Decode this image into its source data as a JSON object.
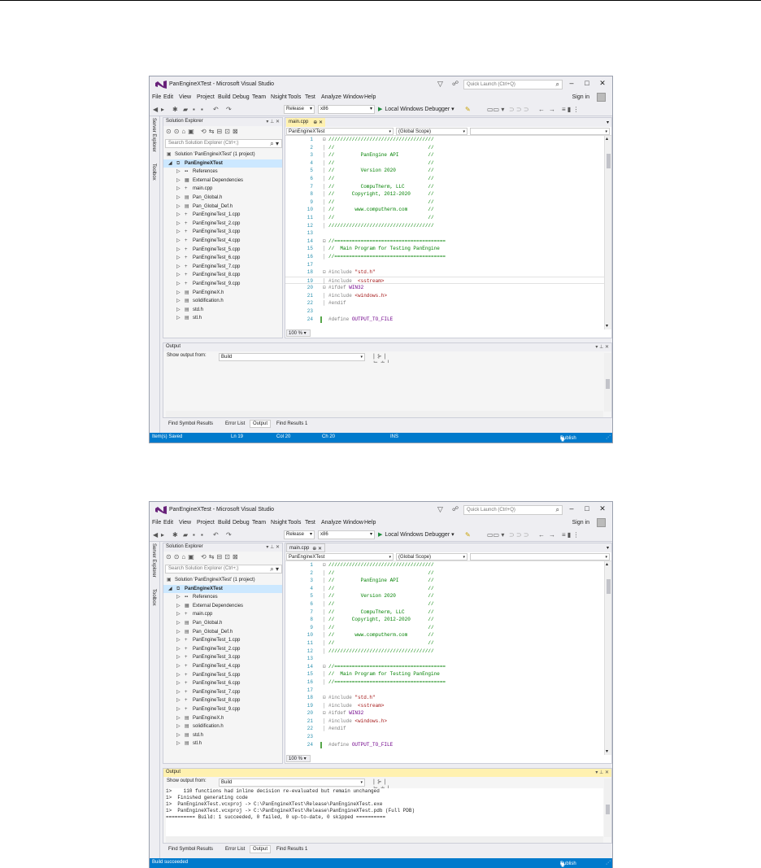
{
  "app": {
    "title": "PanEngineXTest - Microsoft Visual Studio",
    "quick_launch_placeholder": "Quick Launch (Ctrl+Q)",
    "sign_in": "Sign in"
  },
  "icons": {
    "logo": "vs-logo-icon",
    "filter": "filter-icon",
    "feedback": "feedback-icon",
    "search": "search-icon",
    "minimize": "minimize-icon",
    "maximize": "maximize-icon",
    "close": "close-icon"
  },
  "colors": {
    "accent": "#007acc",
    "logo": "#68217a",
    "active_tab": "#fff1b0",
    "selection": "#cce8ff",
    "comment": "#008000",
    "line_number": "#2b91af"
  },
  "menu": [
    "File",
    "Edit",
    "View",
    "Project",
    "Build",
    "Debug",
    "Team",
    "Nsight",
    "Tools",
    "Test",
    "Analyze",
    "Window",
    "Help"
  ],
  "toolbar": {
    "config": "Release",
    "platform": "x86",
    "run": "Local Windows Debugger"
  },
  "side_tabs": [
    "Server Explorer",
    "Toolbox"
  ],
  "solution_explorer": {
    "title": "Solution Explorer",
    "search_placeholder": "Search Solution Explorer (Ctrl+;)",
    "items": [
      {
        "label": "Solution 'PanEngineXTest' (1 project)",
        "level": 0,
        "arrow": "",
        "icon": "▣"
      },
      {
        "label": "PanEngineXTest",
        "level": 1,
        "arrow": "◢",
        "icon": "⧉",
        "bold": true,
        "selected": true
      },
      {
        "label": "References",
        "level": 2,
        "arrow": "▷",
        "icon": "▪▪"
      },
      {
        "label": "External Dependencies",
        "level": 2,
        "arrow": "▷",
        "icon": "▦"
      },
      {
        "label": "main.cpp",
        "level": 2,
        "arrow": "▷",
        "icon": "+"
      },
      {
        "label": "Pan_Global.h",
        "level": 2,
        "arrow": "▷",
        "icon": "▤"
      },
      {
        "label": "Pan_Global_Def.h",
        "level": 2,
        "arrow": "▷",
        "icon": "▤"
      },
      {
        "label": "PanEngineTest_1.cpp",
        "level": 2,
        "arrow": "▷",
        "icon": "+"
      },
      {
        "label": "PanEngineTest_2.cpp",
        "level": 2,
        "arrow": "▷",
        "icon": "+"
      },
      {
        "label": "PanEngineTest_3.cpp",
        "level": 2,
        "arrow": "▷",
        "icon": "+"
      },
      {
        "label": "PanEngineTest_4.cpp",
        "level": 2,
        "arrow": "▷",
        "icon": "+"
      },
      {
        "label": "PanEngineTest_5.cpp",
        "level": 2,
        "arrow": "▷",
        "icon": "+"
      },
      {
        "label": "PanEngineTest_6.cpp",
        "level": 2,
        "arrow": "▷",
        "icon": "+"
      },
      {
        "label": "PanEngineTest_7.cpp",
        "level": 2,
        "arrow": "▷",
        "icon": "+"
      },
      {
        "label": "PanEngineTest_8.cpp",
        "level": 2,
        "arrow": "▷",
        "icon": "+"
      },
      {
        "label": "PanEngineTest_9.cpp",
        "level": 2,
        "arrow": "▷",
        "icon": "+"
      },
      {
        "label": "PanEngineX.h",
        "level": 2,
        "arrow": "▷",
        "icon": "▤"
      },
      {
        "label": "solidification.h",
        "level": 2,
        "arrow": "▷",
        "icon": "▤"
      },
      {
        "label": "std.h",
        "level": 2,
        "arrow": "▷",
        "icon": "▤"
      },
      {
        "label": "stl.h",
        "level": 2,
        "arrow": "▷",
        "icon": "▤"
      }
    ]
  },
  "editor": {
    "tab": "main.cpp",
    "nav_project": "PanEngineXTest",
    "nav_scope": "(Global Scope)",
    "zoom": "100 %",
    "lines": [
      {
        "n": "1",
        "fold": "⊟",
        "t": "comment",
        "code": "////////////////////////////////////"
      },
      {
        "n": "2",
        "fold": "│",
        "t": "comment",
        "code": "//                                //"
      },
      {
        "n": "3",
        "fold": "│",
        "t": "comment",
        "code": "//         PanEngine API          //"
      },
      {
        "n": "4",
        "fold": "│",
        "t": "comment",
        "code": "//                                //"
      },
      {
        "n": "5",
        "fold": "│",
        "t": "comment",
        "code": "//         Version 2020           //"
      },
      {
        "n": "6",
        "fold": "│",
        "t": "comment",
        "code": "//                                //"
      },
      {
        "n": "7",
        "fold": "│",
        "t": "comment",
        "code": "//         CompuTherm, LLC        //"
      },
      {
        "n": "8",
        "fold": "│",
        "t": "comment",
        "code": "//      Copyright, 2012-2020      //"
      },
      {
        "n": "9",
        "fold": "│",
        "t": "comment",
        "code": "//                                //"
      },
      {
        "n": "10",
        "fold": "│",
        "t": "comment",
        "code": "//       www.computherm.com       //"
      },
      {
        "n": "11",
        "fold": "│",
        "t": "comment",
        "code": "//                                //"
      },
      {
        "n": "12",
        "fold": "│",
        "t": "comment",
        "code": "////////////////////////////////////"
      },
      {
        "n": "13",
        "fold": "",
        "t": "plain",
        "code": ""
      },
      {
        "n": "14",
        "fold": "⊟",
        "t": "comment",
        "code": "//======================================"
      },
      {
        "n": "15",
        "fold": "│",
        "t": "comment",
        "code": "//  Main Program for Testing PanEngine"
      },
      {
        "n": "16",
        "fold": "│",
        "t": "comment",
        "code": "//======================================"
      },
      {
        "n": "17",
        "fold": "",
        "t": "plain",
        "code": ""
      },
      {
        "n": "18",
        "fold": "⊟",
        "t": "pre",
        "code": "#include ",
        "str": "\"std.h\""
      },
      {
        "n": "19",
        "fold": "│",
        "t": "pre",
        "code": "#include  ",
        "str": "<sstream>",
        "hl": true
      },
      {
        "n": "20",
        "fold": "⊟",
        "t": "pre",
        "code": "#ifdef ",
        "macro": "WIN32"
      },
      {
        "n": "21",
        "fold": "│",
        "t": "pre",
        "code": "#include ",
        "str": "<windows.h>"
      },
      {
        "n": "22",
        "fold": "│",
        "t": "pre",
        "code": "#endif"
      },
      {
        "n": "23",
        "fold": "",
        "t": "plain",
        "code": ""
      },
      {
        "n": "24",
        "fold": "",
        "t": "pre",
        "code": "#define ",
        "macro": "OUTPUT_TO_FILE",
        "change": true
      }
    ]
  },
  "output": {
    "title": "Output",
    "show_from_label": "Show output from:",
    "source": "Build",
    "lines_after_build": [
      "1>    110 functions had inline decision re-evaluated but remain unchanged",
      "1>  Finished generating code",
      "1>  PanEngineXTest.vcxproj -> C:\\PanEngineXTest\\Release\\PanEngineXTest.exe",
      "1>  PanEngineXTest.vcxproj -> C:\\PanEngineXTest\\Release\\PanEngineXTest.pdb (Full PDB)",
      "========== Build: 1 succeeded, 0 failed, 0 up-to-date, 0 skipped =========="
    ]
  },
  "bottom_tabs": [
    "Find Symbol Results",
    "Error List",
    "Output",
    "Find Results 1"
  ],
  "status_before": {
    "message": "Item(s) Saved",
    "ln": "Ln 19",
    "col": "Col 20",
    "ch": "Ch 20",
    "mode": "INS",
    "publish": "Publish"
  },
  "status_after": {
    "message": "Build succeeded",
    "publish": "Publish"
  }
}
